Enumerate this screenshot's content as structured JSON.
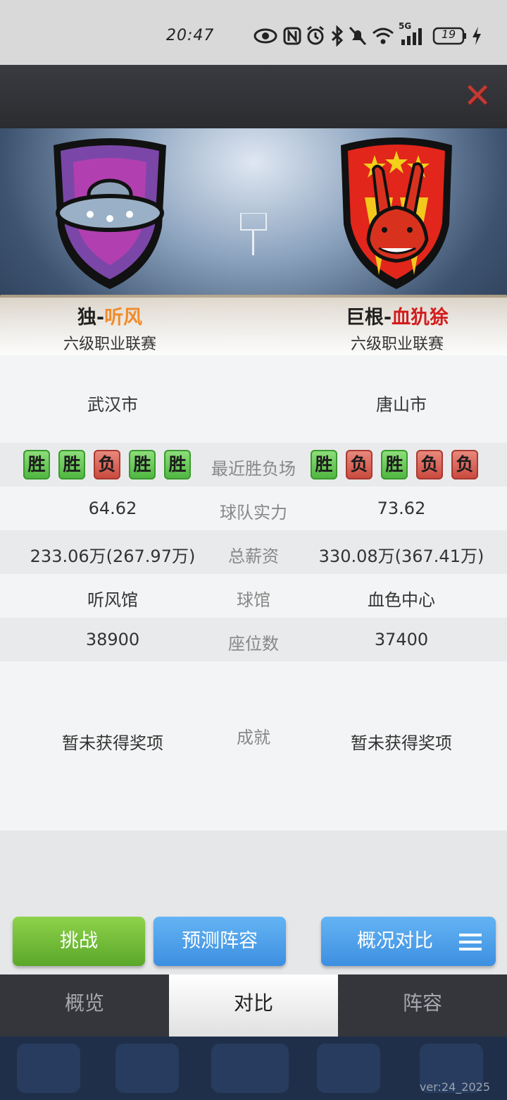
{
  "status_bar": {
    "time": "20:47",
    "icons": [
      "eye-icon",
      "nfc-icon",
      "alarm-icon",
      "bluetooth-icon",
      "mute-icon",
      "wifi-icon",
      "signal-5g-icon",
      "battery-icon",
      "charging-icon"
    ],
    "battery_level": "19",
    "network_label": "5G"
  },
  "header": {
    "close_icon": "close-icon",
    "close_color": "#c23a33"
  },
  "home_team": {
    "prefix": "独-",
    "name": "听风",
    "name_color": "#f08c2a",
    "league": "六级职业联赛",
    "logo": "ufo-shield-logo"
  },
  "away_team": {
    "prefix": "巨根-",
    "name": "血犰狳",
    "name_color": "#d21d1d",
    "league": "六级职业联赛",
    "logo": "rabbit-shield-logo"
  },
  "comparison": {
    "city": {
      "left": "武汉市",
      "right": "唐山市"
    },
    "recent": {
      "label": "最近胜负场",
      "left": [
        "胜",
        "胜",
        "负",
        "胜",
        "胜"
      ],
      "right": [
        "胜",
        "负",
        "胜",
        "负",
        "负"
      ]
    },
    "strength": {
      "label": "球队实力",
      "left": "64.62",
      "right": "73.62"
    },
    "salary": {
      "label": "总薪资",
      "left": "233.06万(267.97万)",
      "right": "330.08万(367.41万)"
    },
    "arena": {
      "label": "球馆",
      "left": "听风馆",
      "right": "血色中心",
      "right_color": "#d21d1d"
    },
    "seats": {
      "label": "座位数",
      "left": "38900",
      "right": "37400"
    },
    "achievements": {
      "label": "成就",
      "left": "暂未获得奖项",
      "right": "暂未获得奖项"
    }
  },
  "buttons": {
    "challenge": "挑战",
    "predict": "预测阵容",
    "overview_compare": "概况对比",
    "menu_icon": "menu-icon"
  },
  "tabs": [
    "概览",
    "对比",
    "阵容"
  ],
  "active_tab": "对比",
  "version": "ver:24_2025"
}
